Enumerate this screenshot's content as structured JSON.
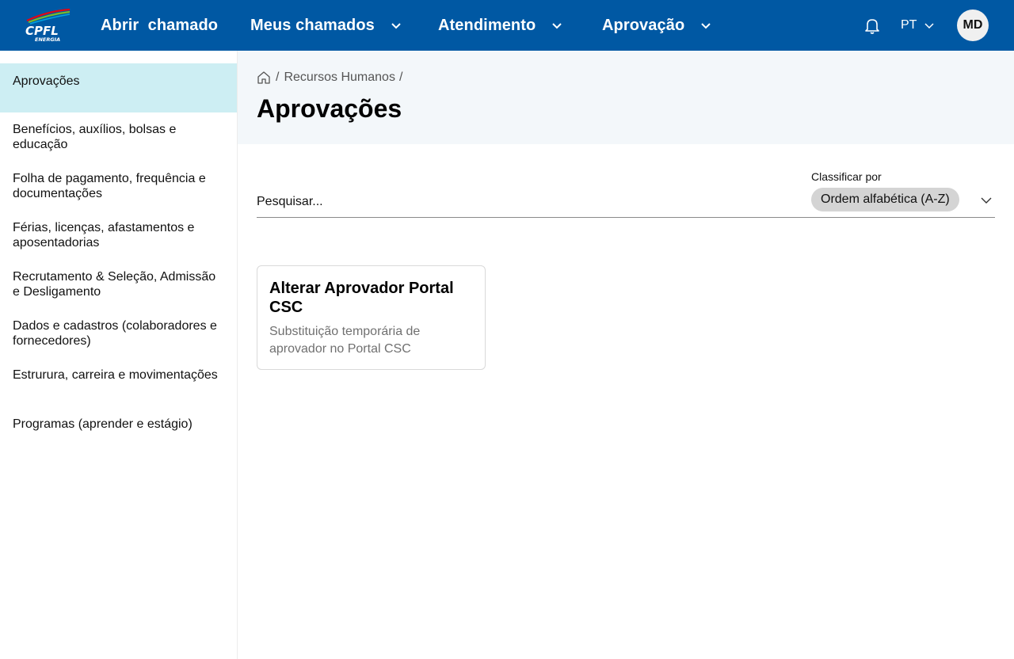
{
  "brand": {
    "logo_text": "CPFL",
    "logo_subtext": "ENERGIA",
    "logo_colors": [
      "#e30613",
      "#7ab929",
      "#00a3e0"
    ]
  },
  "nav": {
    "items": [
      {
        "label": "Abrir  chamado",
        "has_dropdown": false
      },
      {
        "label": "Meus chamados",
        "has_dropdown": true
      },
      {
        "label": "Atendimento",
        "has_dropdown": true
      },
      {
        "label": "Aprovação",
        "has_dropdown": true
      }
    ],
    "notifications_icon": "bell-icon",
    "language": "PT",
    "user_initials": "MD"
  },
  "sidebar": {
    "items": [
      {
        "label": "Aprovações",
        "active": true
      },
      {
        "label": "Benefícios, auxílios, bolsas e educação"
      },
      {
        "label": "Folha de pagamento, frequência e documentações"
      },
      {
        "label": "Férias, licenças, afastamentos e aposentadorias"
      },
      {
        "label": "Recrutamento & Seleção, Admissão e Desligamento"
      },
      {
        "label": "Dados e cadastros (colaboradores e fornecedores)"
      },
      {
        "label": "Estrurura, carreira e movimentações"
      },
      {
        "label": "Programas (aprender e estágio)"
      }
    ]
  },
  "breadcrumb": {
    "home_icon": "home-icon",
    "items": [
      "Recursos Humanos"
    ]
  },
  "page": {
    "title": "Aprovações"
  },
  "search": {
    "placeholder": "Pesquisar...",
    "value": ""
  },
  "sort": {
    "label": "Classificar por",
    "selected": "Ordem alfabética (A-Z)"
  },
  "cards": [
    {
      "title": "Alterar Aprovador Portal CSC",
      "description": "Substituição temporária de aprovador no Portal CSC"
    }
  ],
  "colors": {
    "topbar": "#0058a3",
    "sidebar_active": "#cdeef3",
    "header_bg": "#f3f7fa",
    "pill_bg": "#d4d4d4"
  }
}
